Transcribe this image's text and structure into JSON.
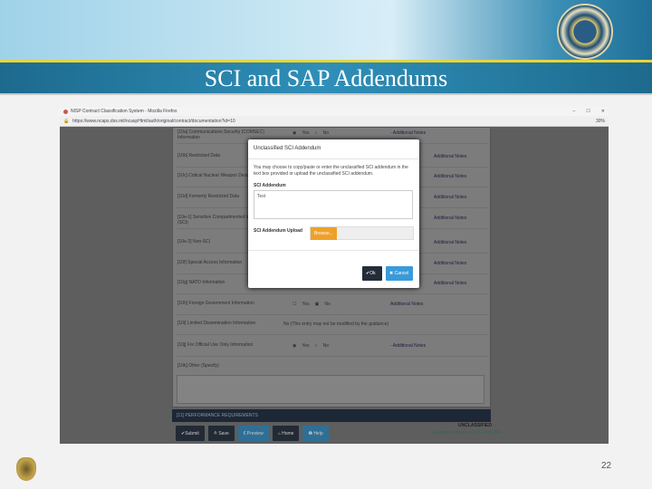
{
  "slide": {
    "title": "SCI and SAP Addendums",
    "page_number": "22"
  },
  "browser": {
    "window_title": "NISP Contract Classification System - Mozilla Firefox",
    "url": "https://www.ncaps.dss.mil/ncaspHtml/auth/original/contract/documentation?id=10",
    "zoom": "30%",
    "min": "–",
    "max": "☐",
    "close": "✕"
  },
  "form": {
    "rows": [
      {
        "label": "[10a] Communications Security (COMSEC) Information",
        "yes": "Yes",
        "no": "No",
        "note": "- Additional Notes"
      },
      {
        "label": "[10b] Restricted Data",
        "note": "Additional Notes"
      },
      {
        "label": "[10c] Critical Nuclear Weapon Design Information",
        "note": "Additional Notes"
      },
      {
        "label": "[10d] Formerly Restricted Data",
        "note": "Additional Notes"
      },
      {
        "label": "[10e-1] Sensitive Compartmented Information (SCI)",
        "note": "Additional Notes"
      },
      {
        "label": "[10e-2] Non-SCI",
        "note": "Additional Notes"
      },
      {
        "label": "[10f] Special Access Information",
        "note": "Additional Notes"
      },
      {
        "label": "[10g] NATO Information",
        "note": "Additional Notes"
      },
      {
        "label": "[10h] Foreign Government Information",
        "yes": "Yes",
        "no": "No",
        "note": "Additional Notes"
      },
      {
        "label": "[10i] Limited Dissemination Information",
        "value": "No (This entry may not be modified by the guidance)"
      },
      {
        "label": "[10j] For Official Use Only Information",
        "yes": "Yes",
        "no": "No",
        "note": "- Additional Notes"
      },
      {
        "label": "[10k] Other (Specify)"
      }
    ],
    "section": "[11] PERFORMANCE REQUIREMENTS",
    "buttons": {
      "submit": "✔Submit",
      "save": "≛ Save",
      "preview": "€ Preview",
      "home": "⌂ Home",
      "help": "❶ Help"
    },
    "classification": "UNCLASSIFIED",
    "form_id": "Electronic Version of DD Form 254"
  },
  "modal": {
    "title": "Unclassified SCI Addendum",
    "text": "You may choose to copy/paste or enter the unclassified SCI addendum in the text box provided or upload the unclassified SCI addendum.",
    "addendum_label": "SCI Addendum",
    "addendum_value": "Test",
    "upload_label": "SCI Addendum Upload",
    "browse": "Browse...",
    "ok": "✔Ok",
    "cancel": "✖ Cancel"
  }
}
